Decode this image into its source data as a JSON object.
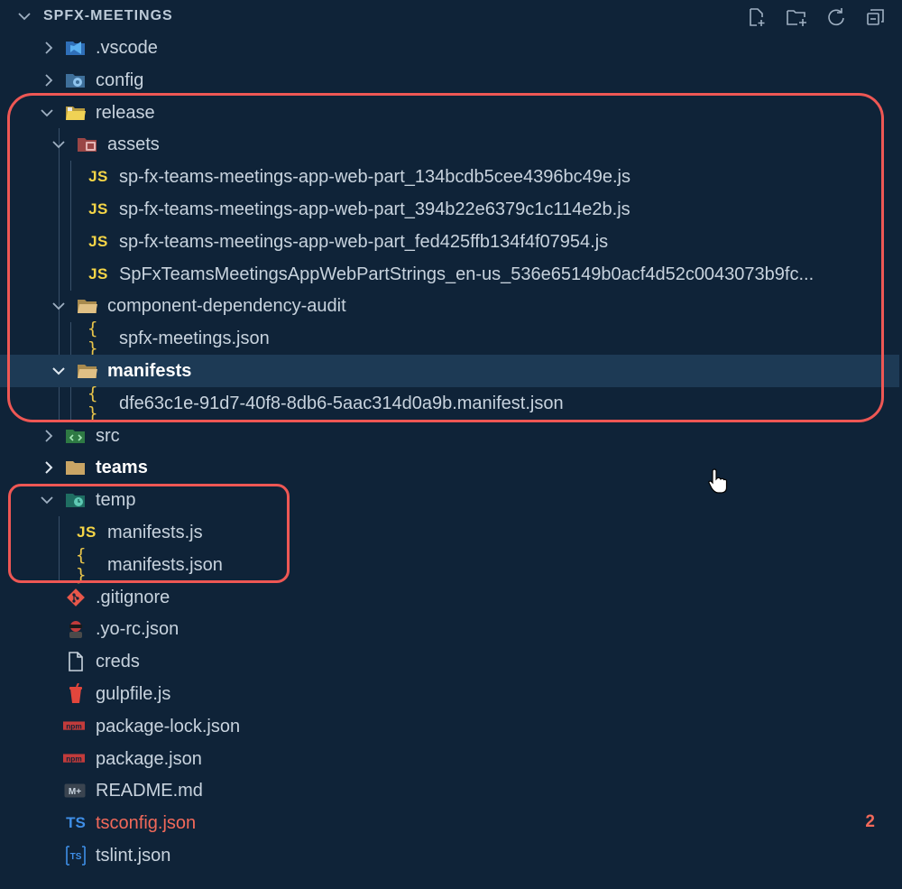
{
  "explorer": {
    "title": "SPFX-MEETINGS",
    "actions": [
      {
        "name": "new-file-icon"
      },
      {
        "name": "new-folder-icon"
      },
      {
        "name": "refresh-icon"
      },
      {
        "name": "collapse-all-icon"
      }
    ]
  },
  "tree": [
    {
      "label": ".vscode",
      "icon": "vscode-folder-icon",
      "icon_color": "#3a85d8",
      "twisty": "collapsed"
    },
    {
      "label": "config",
      "icon": "config-folder-icon",
      "icon_color": "#4a8fcf",
      "twisty": "collapsed"
    },
    {
      "label": "release",
      "icon": "release-folder-icon",
      "icon_color": "#e8c84e",
      "twisty": "expanded"
    },
    {
      "label": "assets",
      "icon": "assets-folder-icon",
      "icon_color": "#c95a5a",
      "twisty": "expanded"
    },
    {
      "label": "sp-fx-teams-meetings-app-web-part_134bcdb5cee4396bc49e.js",
      "icon": "js-file-icon"
    },
    {
      "label": "sp-fx-teams-meetings-app-web-part_394b22e6379c1c114e2b.js",
      "icon": "js-file-icon"
    },
    {
      "label": "sp-fx-teams-meetings-app-web-part_fed425ffb134f4f07954.js",
      "icon": "js-file-icon"
    },
    {
      "label": "SpFxTeamsMeetingsAppWebPartStrings_en-us_536e65149b0acf4d52c0043073b9fc...",
      "icon": "js-file-icon"
    },
    {
      "label": "component-dependency-audit",
      "icon": "folder-icon",
      "icon_color": "#d9b56c",
      "twisty": "expanded"
    },
    {
      "label": "spfx-meetings.json",
      "icon": "json-file-icon"
    },
    {
      "label": "manifests",
      "icon": "folder-icon",
      "icon_color": "#d9b56c",
      "twisty": "expanded"
    },
    {
      "label": "dfe63c1e-91d7-40f8-8db6-5aac314d0a9b.manifest.json",
      "icon": "json-file-icon"
    },
    {
      "label": "src",
      "icon": "src-folder-icon",
      "icon_color": "#3fa35a",
      "twisty": "collapsed"
    },
    {
      "label": "teams",
      "icon": "folder-icon",
      "icon_color": "#d9b56c",
      "twisty": "collapsed"
    },
    {
      "label": "temp",
      "icon": "temp-folder-icon",
      "icon_color": "#2f9c8a",
      "twisty": "expanded"
    },
    {
      "label": "manifests.js",
      "icon": "js-file-icon"
    },
    {
      "label": "manifests.json",
      "icon": "json-file-icon"
    },
    {
      "label": ".gitignore",
      "icon": "git-icon",
      "icon_color": "#e8574a"
    },
    {
      "label": ".yo-rc.json",
      "icon": "yeoman-icon",
      "icon_color": "#c23b3b"
    },
    {
      "label": "creds",
      "icon": "file-icon"
    },
    {
      "label": "gulpfile.js",
      "icon": "gulp-icon",
      "icon_color": "#e2463c"
    },
    {
      "label": "package-lock.json",
      "icon": "npm-icon",
      "icon_color": "#c23b3b"
    },
    {
      "label": "package.json",
      "icon": "npm-icon",
      "icon_color": "#c23b3b"
    },
    {
      "label": "README.md",
      "icon": "markdown-icon"
    },
    {
      "label": "tsconfig.json",
      "icon": "ts-config-icon",
      "badge": "2",
      "state": "error"
    },
    {
      "label": "tslint.json",
      "icon": "tslint-icon"
    }
  ],
  "icon_text": {
    "js": "JS",
    "json": "{ }",
    "ts": "TS",
    "md": "M+",
    "npm": "npm"
  },
  "colors": {
    "background": "#0f2338",
    "selected_row": "#1d3a55",
    "highlight_box": "#ee5754",
    "error_text": "#f2695a"
  }
}
